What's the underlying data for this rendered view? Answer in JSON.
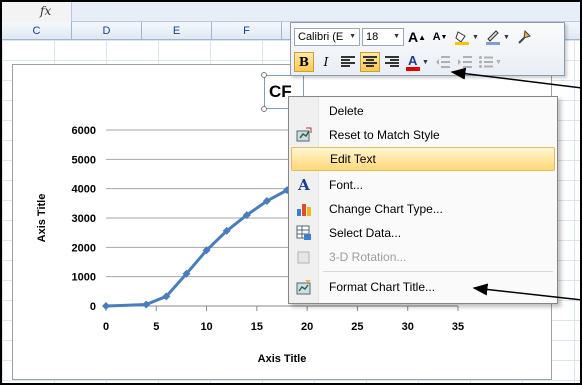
{
  "formula_bar": {
    "fx_label": "fx"
  },
  "columns": [
    "C",
    "D",
    "E",
    "F"
  ],
  "chart": {
    "title_visible": "CF",
    "y_axis_title": "Axis Title",
    "x_axis_title": "Axis Title",
    "line_color": "#4a7ebb"
  },
  "chart_data": {
    "type": "scatter",
    "title": "CF",
    "xlabel": "Axis Title",
    "ylabel": "Axis Title",
    "xlim": [
      0,
      35
    ],
    "ylim": [
      0,
      6000
    ],
    "x_ticks": [
      "0",
      "5",
      "10",
      "15",
      "20",
      "25",
      "30",
      "35"
    ],
    "y_ticks": [
      "0",
      "1000",
      "2000",
      "3000",
      "4000",
      "5000",
      "6000"
    ],
    "grid": true,
    "series": [
      {
        "x": [
          0,
          4,
          6,
          8,
          10,
          12,
          14,
          16,
          18,
          20
        ],
        "y": [
          0,
          50,
          330,
          1100,
          1900,
          2560,
          3100,
          3580,
          3950,
          4230
        ]
      }
    ]
  },
  "mini_toolbar": {
    "font_name": "Calibri (E",
    "font_size": "18",
    "grow_font": "A",
    "shrink_font": "A",
    "bold": "B",
    "italic": "I",
    "font_color_letter": "A"
  },
  "context_menu": {
    "items": [
      {
        "label": "Delete",
        "icon": "none"
      },
      {
        "label": "Reset to Match Style",
        "icon": "reset-style-icon"
      },
      {
        "label": "Edit Text",
        "icon": "none"
      },
      {
        "label": "Font...",
        "icon": "font-icon"
      },
      {
        "label": "Change Chart Type...",
        "icon": "chart-type-icon"
      },
      {
        "label": "Select Data...",
        "icon": "select-data-icon"
      },
      {
        "label": "3-D Rotation...",
        "icon": "rotation-icon"
      },
      {
        "label": "Format Chart Title...",
        "icon": "format-title-icon"
      }
    ]
  },
  "colors": {
    "highlight": "#ffd778",
    "menu_border": "#868686",
    "axis_line": "#4a7ebb"
  }
}
